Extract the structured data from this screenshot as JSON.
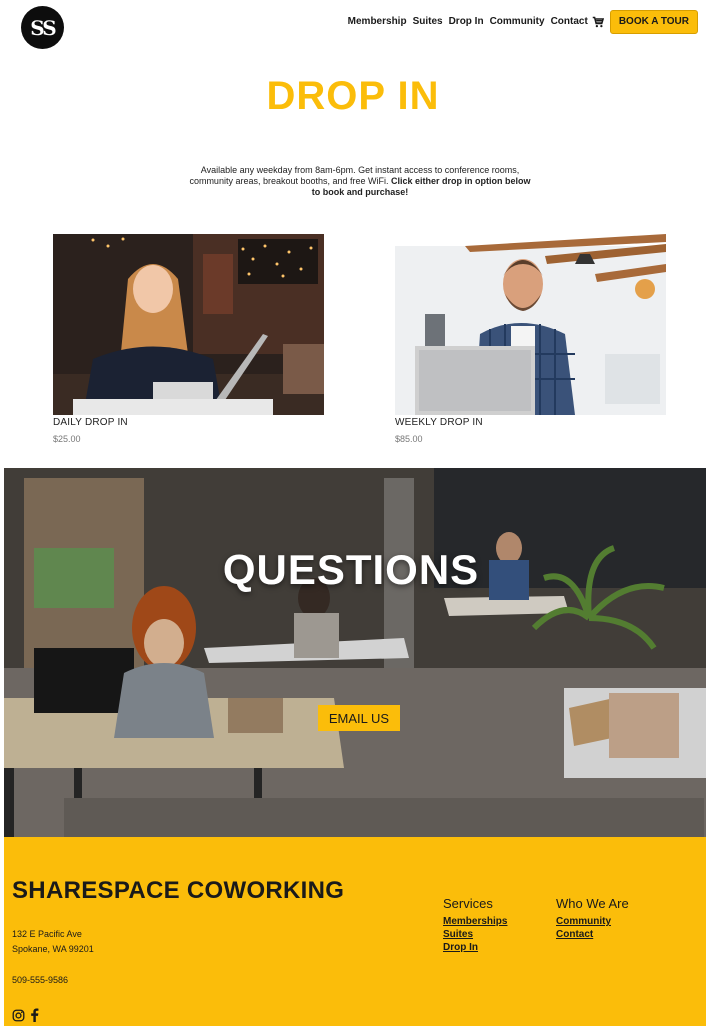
{
  "header": {
    "logo_text": "SS",
    "nav": [
      "Membership",
      "Suites",
      "Drop In",
      "Community",
      "Contact"
    ],
    "cart_icon": "cart-icon",
    "cta": "BOOK A TOUR"
  },
  "colors": {
    "accent": "#fbbd0a",
    "text": "#1a1a1a",
    "muted": "#777777"
  },
  "page": {
    "title": "DROP IN",
    "intro_plain": "Available any weekday from 8am-6pm. Get instant access to conference rooms, community areas, breakout booths, and free WiFi. ",
    "intro_bold": "Click either drop in option below to book and purchase!"
  },
  "products": [
    {
      "name": "DAILY DROP IN",
      "price": "$25.00"
    },
    {
      "name": "WEEKLY DROP IN",
      "price": "$85.00"
    }
  ],
  "banner": {
    "title": "QUESTIONS",
    "button": "EMAIL US"
  },
  "footer": {
    "brand": "SHARESPACE COWORKING",
    "address_line1": "132 E Pacific Ave",
    "address_line2": "Spokane, WA 99201",
    "phone": "509-555-9586",
    "social_icons": [
      "instagram-icon",
      "facebook-icon"
    ],
    "services": {
      "heading": "Services",
      "links": [
        "Memberships",
        "Suites",
        "Drop In"
      ]
    },
    "who": {
      "heading": "Who We Are",
      "links": [
        "Community",
        "Contact"
      ]
    }
  }
}
